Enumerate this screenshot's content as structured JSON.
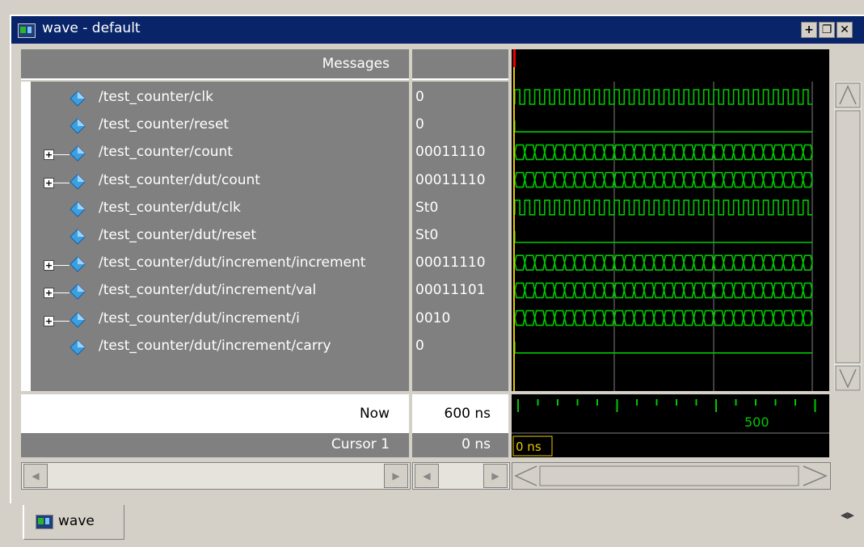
{
  "window": {
    "title": "wave - default",
    "buttons": [
      "+",
      "❐",
      "✕"
    ]
  },
  "messages_header": "Messages",
  "signals": [
    {
      "name": "/test_counter/clk",
      "value": "0",
      "expandable": false
    },
    {
      "name": "/test_counter/reset",
      "value": "0",
      "expandable": false
    },
    {
      "name": "/test_counter/count",
      "value": "00011110",
      "expandable": true
    },
    {
      "name": "/test_counter/dut/count",
      "value": "00011110",
      "expandable": true
    },
    {
      "name": "/test_counter/dut/clk",
      "value": "St0",
      "expandable": false
    },
    {
      "name": "/test_counter/dut/reset",
      "value": "St0",
      "expandable": false
    },
    {
      "name": "/test_counter/dut/increment/increment",
      "value": "00011110",
      "expandable": true
    },
    {
      "name": "/test_counter/dut/increment/val",
      "value": "00011101",
      "expandable": true
    },
    {
      "name": "/test_counter/dut/increment/i",
      "value": "0010",
      "expandable": true
    },
    {
      "name": "/test_counter/dut/increment/carry",
      "value": "0",
      "expandable": false
    }
  ],
  "now": {
    "label": "Now",
    "value": "600 ns"
  },
  "cursor": {
    "label": "Cursor 1",
    "value": "0 ns",
    "marker": "0 ns"
  },
  "timeline": {
    "label": "500"
  },
  "tab": {
    "label": "wave"
  },
  "colors": {
    "wave": "#00c800",
    "cursor": "#e8c800",
    "background": "#000000"
  }
}
